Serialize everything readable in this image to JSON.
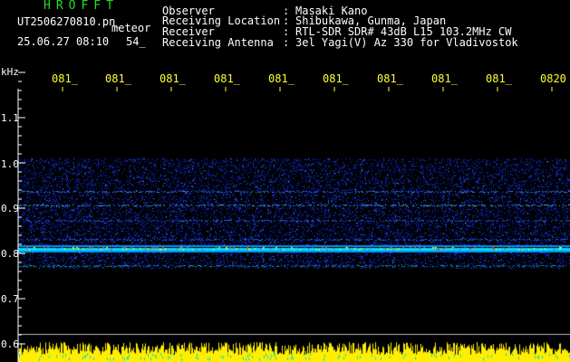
{
  "header": {
    "app_title": "HROFFT",
    "file_name": "UT2506270810.pn_",
    "file_tag": "meteor",
    "date_time": "25.06.27 08:10",
    "frame_no": "54_",
    "fields": [
      {
        "key": "Observer",
        "value": "Masaki Kano"
      },
      {
        "key": "Receiving Location",
        "value": "Shibukawa, Gunma, Japan"
      },
      {
        "key": "Receiver",
        "value": "RTL-SDR SDR# 43dB L15 103.2MHz CW"
      },
      {
        "key": "Receiving Antenna",
        "value": "3el Yagi(V) Az 330 for Vladivostok"
      }
    ],
    "separator": ":"
  },
  "axes": {
    "unit": "kHz",
    "time_ticks": [
      "081_",
      "081_",
      "081_",
      "081_",
      "081_",
      "081_",
      "081_",
      "081_",
      "081_",
      "0820"
    ],
    "freq_ticks": [
      "1.1",
      "1.0",
      "0.9",
      "0.8",
      "0.7",
      "0.6"
    ]
  },
  "colors": {
    "background": "#000000",
    "title": "#22dd22",
    "time_ticks": "#ffff33",
    "noise_blue": "#1030ff",
    "signal_cyan": "#00ddff",
    "meteor_red": "#ff3020",
    "bottom_bars": "#ffee00",
    "bottom_bars_alt": "#00dddd",
    "gridline": "#cccccc"
  }
}
